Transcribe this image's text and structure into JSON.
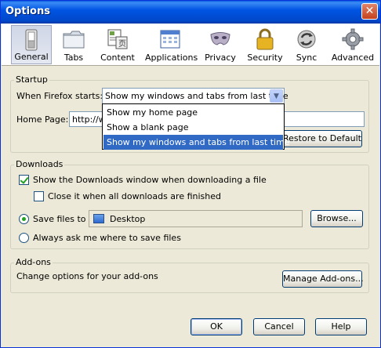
{
  "window": {
    "title": "Options",
    "close_glyph": "✕"
  },
  "toolbar": {
    "items": [
      {
        "label": "General",
        "icon": "switch-icon",
        "selected": true
      },
      {
        "label": "Tabs",
        "icon": "tabs-folder-icon",
        "selected": false
      },
      {
        "label": "Content",
        "icon": "content-page-icon",
        "selected": false
      },
      {
        "label": "Applications",
        "icon": "applications-calendar-icon",
        "selected": false
      },
      {
        "label": "Privacy",
        "icon": "privacy-mask-icon",
        "selected": false
      },
      {
        "label": "Security",
        "icon": "padlock-icon",
        "selected": false
      },
      {
        "label": "Sync",
        "icon": "sync-icon",
        "selected": false
      },
      {
        "label": "Advanced",
        "icon": "gear-icon",
        "selected": false
      }
    ]
  },
  "startup": {
    "group_label": "Startup",
    "when_starts_label": "When Firefox starts:",
    "when_starts_value": "Show my windows and tabs from last time",
    "options": [
      "Show my home page",
      "Show a blank page",
      "Show my windows and tabs from last time"
    ],
    "home_page_label": "Home Page:",
    "home_page_value": "http://w",
    "restore_default_label": "Restore to Default"
  },
  "downloads": {
    "group_label": "Downloads",
    "show_window_label": "Show the Downloads window when downloading a file",
    "show_window_checked": true,
    "close_when_done_label": "Close it when all downloads are finished",
    "close_when_done_checked": false,
    "save_files_label": "Save files to",
    "save_files_selected": true,
    "save_folder": "Desktop",
    "browse_label": "Browse...",
    "always_ask_label": "Always ask me where to save files",
    "always_ask_selected": false
  },
  "addons": {
    "group_label": "Add-ons",
    "description": "Change options for your add-ons",
    "manage_label": "Manage Add-ons..."
  },
  "footer": {
    "ok_label": "OK",
    "cancel_label": "Cancel",
    "help_label": "Help"
  },
  "colors": {
    "titlebar": "#0054e3",
    "selection": "#316ac5",
    "dialog_bg": "#ece9d8"
  }
}
